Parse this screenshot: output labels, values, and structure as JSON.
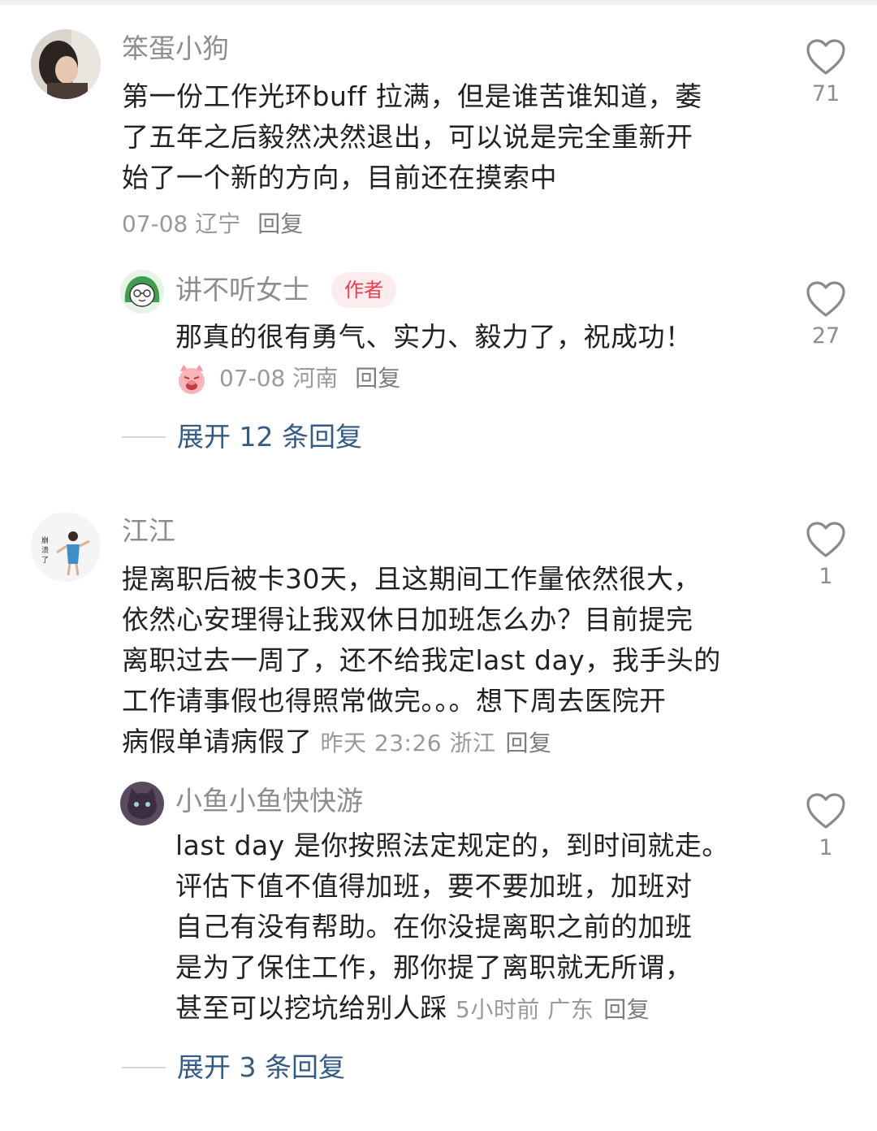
{
  "comments": [
    {
      "username": "笨蛋小狗",
      "lines": [
        "第一份工作光环buff 拉满，但是谁苦谁知道，萎",
        "了五年之后毅然决然退出，可以说是完全重新开",
        "始了一个新的方向，目前还在摸索中"
      ],
      "date": "07-08",
      "location": "辽宁",
      "reply_label": "回复",
      "likes": "71",
      "reply": {
        "username": "讲不听女士",
        "badge": "作者",
        "text": "那真的很有勇气、实力、毅力了，祝成功！",
        "date": "07-08",
        "location": "河南",
        "reply_label": "回复",
        "likes": "27"
      },
      "expand_label": "展开 12 条回复"
    },
    {
      "username": "江江",
      "avatar_caption": "崩溃了",
      "lines": [
        "提离职后被卡30天，且这期间工作量依然很大，",
        "依然心安理得让我双休日加班怎么办？目前提完",
        "离职过去一周了，还不给我定last day，我手头的",
        "工作请事假也得照常做完。。。想下周去医院开",
        "病假单请病假了"
      ],
      "date": "昨天 23:26",
      "location": "浙江",
      "reply_label": "回复",
      "likes": "1",
      "reply": {
        "username": "小鱼小鱼快快游",
        "lines": [
          "last day 是你按照法定规定的，到时间就走。",
          "评估下值不值得加班，要不要加班，加班对",
          "自己有没有帮助。在你没提离职之前的加班",
          "是为了保住工作，那你提了离职就无所谓，",
          "甚至可以挖坑给别人踩"
        ],
        "date": "5小时前",
        "location": "广东",
        "reply_label": "回复",
        "likes": "1"
      },
      "expand_label": "展开 3 条回复"
    }
  ]
}
